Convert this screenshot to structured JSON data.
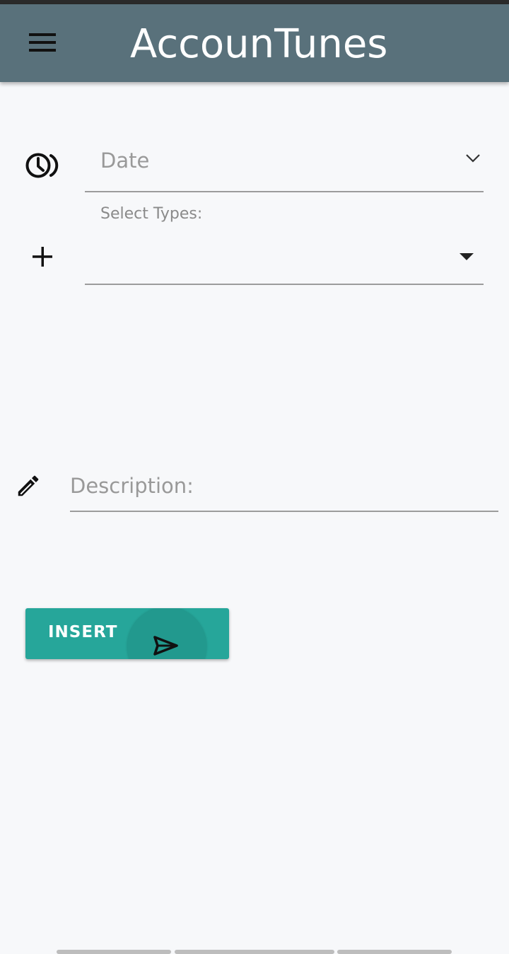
{
  "app_bar": {
    "title": "AccounTunes",
    "menu_icon": "menu-icon",
    "color": "#59717b"
  },
  "form": {
    "date": {
      "label": "Date",
      "icon": "history-clock-icon",
      "dropdown_icon": "chevron-down-icon"
    },
    "types": {
      "label": "Select Types:",
      "value": "",
      "icon": "add-icon",
      "dropdown_icon": "caret-down-icon"
    },
    "description": {
      "placeholder": "Description:",
      "value": "",
      "icon": "pencil-icon"
    },
    "insert_button": {
      "label": "INSERT",
      "icon": "send-icon",
      "color": "#26a69a"
    }
  }
}
